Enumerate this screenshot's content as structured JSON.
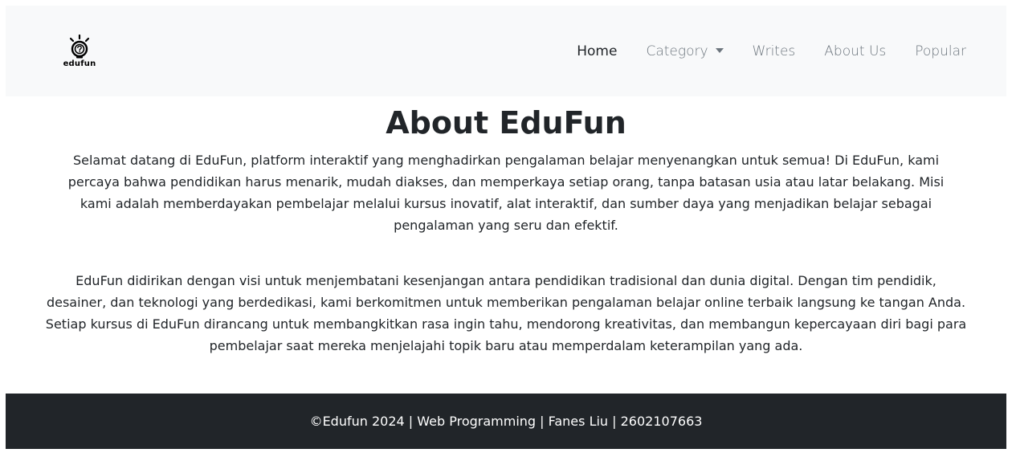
{
  "brand": {
    "name": "edufun",
    "icon": "lightbulb-question-icon"
  },
  "nav": {
    "items": [
      {
        "label": "Home",
        "active": true
      },
      {
        "label": "Category",
        "dropdown": true
      },
      {
        "label": "Writes"
      },
      {
        "label": "About Us"
      },
      {
        "label": "Popular"
      }
    ]
  },
  "main": {
    "title": "About EduFun",
    "paragraphs": [
      "Selamat datang di EduFun, platform interaktif yang menghadirkan pengalaman belajar menyenangkan untuk semua! Di EduFun, kami percaya bahwa pendidikan harus menarik, mudah diakses, dan memperkaya setiap orang, tanpa batasan usia atau latar belakang. Misi kami adalah memberdayakan pembelajar melalui kursus inovatif, alat interaktif, dan sumber daya yang menjadikan belajar sebagai pengalaman yang seru dan efektif.",
      "EduFun didirikan dengan visi untuk menjembatani kesenjangan antara pendidikan tradisional dan dunia digital. Dengan tim pendidik, desainer, dan teknologi yang berdedikasi, kami berkomitmen untuk memberikan pengalaman belajar online terbaik langsung ke tangan Anda. Setiap kursus di EduFun dirancang untuk membangkitkan rasa ingin tahu, mendorong kreativitas, dan membangun kepercayaan diri bagi para pembelajar saat mereka menjelajahi topik baru atau memperdalam keterampilan yang ada."
    ]
  },
  "footer": {
    "text": "©Edufun 2024 | Web Programming | Fanes Liu | 2602107663"
  },
  "colors": {
    "navbar_bg": "#f8f9fa",
    "footer_bg": "#212529",
    "text": "#212529",
    "muted": "#6c757d"
  }
}
